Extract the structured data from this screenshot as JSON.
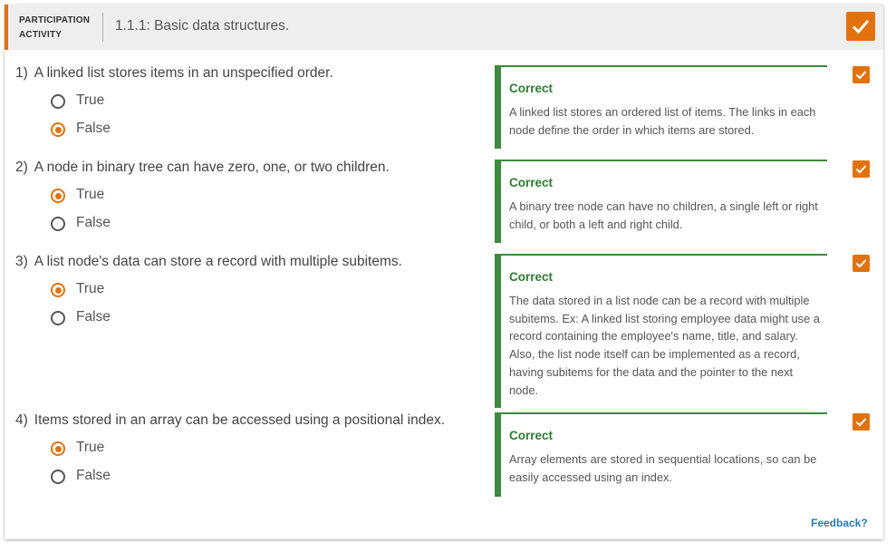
{
  "header": {
    "label_line1": "PARTICIPATION",
    "label_line2": "ACTIVITY",
    "title": "1.1.1: Basic data structures."
  },
  "questions": [
    {
      "number": "1)",
      "text": "A linked list stores items in an unspecified order.",
      "options": [
        {
          "label": "True",
          "selected": false
        },
        {
          "label": "False",
          "selected": true
        }
      ],
      "feedback_title": "Correct",
      "feedback_text": "A linked list stores an ordered list of items. The links in each node define the order in which items are stored."
    },
    {
      "number": "2)",
      "text": "A node in binary tree can have zero, one, or two children.",
      "options": [
        {
          "label": "True",
          "selected": true
        },
        {
          "label": "False",
          "selected": false
        }
      ],
      "feedback_title": "Correct",
      "feedback_text": "A binary tree node can have no children, a single left or right child, or both a left and right child."
    },
    {
      "number": "3)",
      "text": "A list node's data can store a record with multiple subitems.",
      "options": [
        {
          "label": "True",
          "selected": true
        },
        {
          "label": "False",
          "selected": false
        }
      ],
      "feedback_title": "Correct",
      "feedback_text": "The data stored in a list node can be a record with multiple subitems. Ex: A linked list storing employee data might use a record containing the employee's name, title, and salary. Also, the list node itself can be implemented as a record, having subitems for the data and the pointer to the next node."
    },
    {
      "number": "4)",
      "text": "Items stored in an array can be accessed using a positional index.",
      "options": [
        {
          "label": "True",
          "selected": true
        },
        {
          "label": "False",
          "selected": false
        }
      ],
      "feedback_title": "Correct",
      "feedback_text": "Array elements are stored in sequential locations, so can be easily accessed using an index."
    }
  ],
  "feedback_link": "Feedback?",
  "colors": {
    "accent": "#e1720d",
    "correct": "#3e8a3e",
    "link": "#2a7ab5"
  },
  "icons": {
    "activity_done": "checkmark-icon",
    "question_done": "checkmark-icon"
  }
}
